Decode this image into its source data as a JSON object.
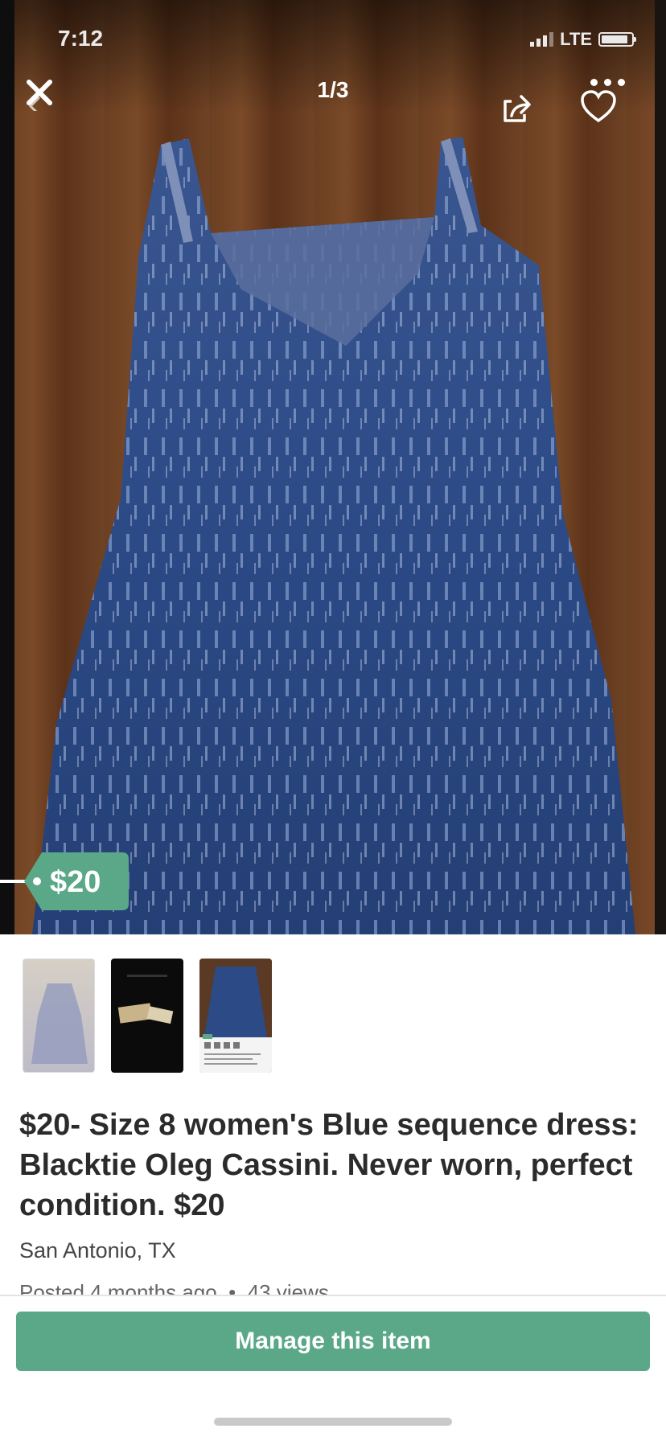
{
  "status_bar": {
    "time": "7:12",
    "network": "LTE"
  },
  "gallery": {
    "counter": "1/3",
    "price_tag": "$20",
    "thumbnails": [
      "photo-1",
      "photo-2",
      "photo-3"
    ]
  },
  "listing": {
    "title": "$20- Size 8 women's Blue sequence dress: Blacktie Oleg Cassini. Never worn, perfect condition. $20",
    "location": "San Antonio, TX",
    "posted": "Posted 4 months ago",
    "views": "43 views"
  },
  "actions": {
    "manage_label": "Manage this item"
  },
  "colors": {
    "accent_green": "#5aa888",
    "dress_blue": "#2b4a86",
    "floor_brown": "#6b3f22"
  },
  "icons": [
    "close-icon",
    "back-chevron-icon",
    "share-icon",
    "heart-icon",
    "more-icon"
  ]
}
